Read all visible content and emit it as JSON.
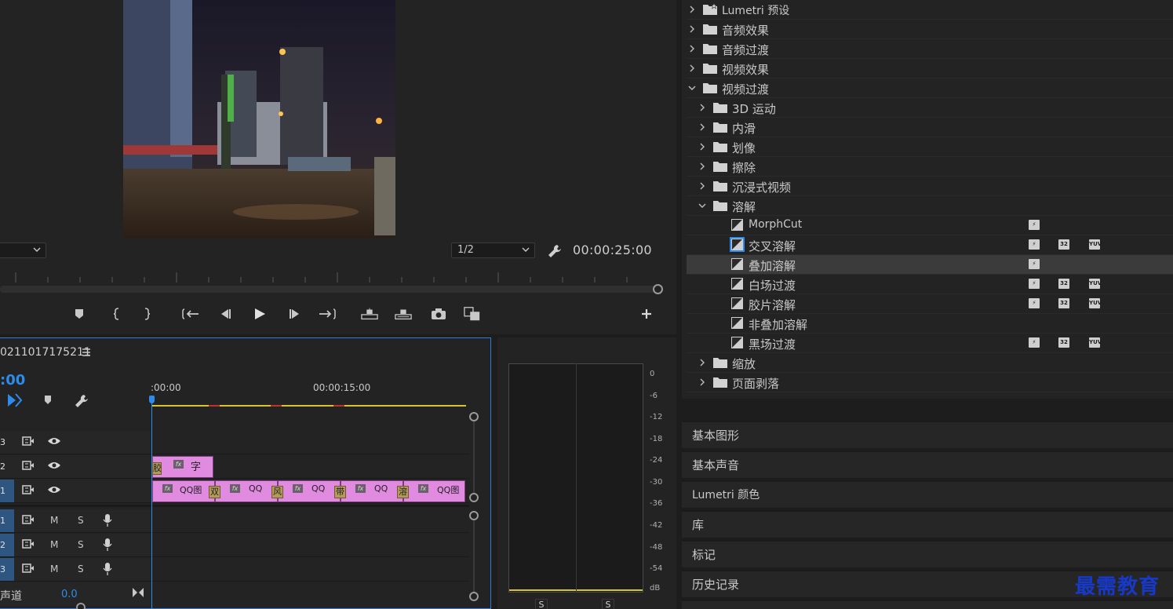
{
  "monitor": {
    "fit_value": "",
    "resolution_value": "1/2",
    "timecode": "00:00:25:00"
  },
  "timeline": {
    "sequence_name": "0211017175211",
    "timecode": ":00",
    "ruler": {
      "start": ":00:00",
      "mark_15": "00:00:15:00"
    },
    "tracks": {
      "v3": {
        "label": "3"
      },
      "v2": {
        "label": "2"
      },
      "v1": {
        "label": "1"
      },
      "a1": {
        "label": "1",
        "mute": "M",
        "solo": "S"
      },
      "a2": {
        "label": "2",
        "mute": "M",
        "solo": "S"
      },
      "a3": {
        "label": "3",
        "mute": "M",
        "solo": "S"
      }
    },
    "master": {
      "label": "声道",
      "value": "0.0"
    },
    "v2_clips": {
      "first": "胶",
      "title": "字",
      "fx": "fx"
    },
    "v1_clips": [
      {
        "fx": "fx",
        "label": "QQ图"
      },
      {
        "fx": "fx",
        "label": "QQ"
      },
      {
        "fx": "fx",
        "label": "QQ"
      },
      {
        "fx": "fx",
        "label": "QQ"
      },
      {
        "fx": "fx",
        "label": "QQ图"
      }
    ],
    "transitions": [
      "双",
      "风",
      "带",
      "溶"
    ]
  },
  "meters": {
    "db_labels": [
      "0",
      "-6",
      "-12",
      "-18",
      "-24",
      "-30",
      "-36",
      "-42",
      "-48",
      "-54",
      "dB"
    ],
    "solo_left": "S",
    "solo_right": "S"
  },
  "effects": {
    "rows": [
      {
        "label": "Lumetri 预设",
        "type": "folder-star",
        "level": 0,
        "open": false
      },
      {
        "label": "音频效果",
        "type": "folder",
        "level": 0,
        "open": false
      },
      {
        "label": "音频过渡",
        "type": "folder",
        "level": 0,
        "open": false
      },
      {
        "label": "视频效果",
        "type": "folder",
        "level": 0,
        "open": false
      },
      {
        "label": "视频过渡",
        "type": "folder",
        "level": 0,
        "open": true
      },
      {
        "label": "3D 运动",
        "type": "folder",
        "level": 1,
        "open": false
      },
      {
        "label": "内滑",
        "type": "folder",
        "level": 1,
        "open": false
      },
      {
        "label": "划像",
        "type": "folder",
        "level": 1,
        "open": false
      },
      {
        "label": "擦除",
        "type": "folder",
        "level": 1,
        "open": false
      },
      {
        "label": "沉浸式视频",
        "type": "folder",
        "level": 1,
        "open": false
      },
      {
        "label": "溶解",
        "type": "folder",
        "level": 1,
        "open": true
      },
      {
        "label": "MorphCut",
        "type": "transition",
        "level": 2,
        "badges": [
          "accel"
        ]
      },
      {
        "label": "交叉溶解",
        "type": "transition",
        "level": 2,
        "focus": true,
        "badges": [
          "accel",
          "32",
          "yuv"
        ]
      },
      {
        "label": "叠加溶解",
        "type": "transition",
        "level": 2,
        "selected": true,
        "badges": [
          "accel"
        ]
      },
      {
        "label": "白场过渡",
        "type": "transition",
        "level": 2,
        "badges": [
          "accel",
          "32",
          "yuv"
        ]
      },
      {
        "label": "胶片溶解",
        "type": "transition",
        "level": 2,
        "badges": [
          "accel",
          "32",
          "yuv"
        ]
      },
      {
        "label": "非叠加溶解",
        "type": "transition",
        "level": 2,
        "badges": []
      },
      {
        "label": "黑场过渡",
        "type": "transition",
        "level": 2,
        "badges": [
          "accel",
          "32",
          "yuv"
        ]
      },
      {
        "label": "缩放",
        "type": "folder",
        "level": 1,
        "open": false
      },
      {
        "label": "页面剥落",
        "type": "folder",
        "level": 1,
        "open": false
      }
    ],
    "badge_text": {
      "accel": "⚡",
      "32": "32",
      "yuv": "YUV"
    }
  },
  "panels": [
    "基本图形",
    "基本声音",
    "Lumetri 颜色",
    "库",
    "标记",
    "历史记录"
  ],
  "watermark": "最需教育",
  "colors": {
    "accent": "#2d8ceb",
    "clip": "#e08ae0",
    "transition": "#b49b5a",
    "watermark": "#1739c9"
  }
}
